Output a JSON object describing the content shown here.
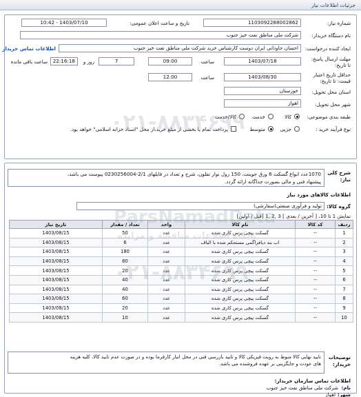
{
  "header": {
    "title": "جزئیات اطلاعات نیاز"
  },
  "form": {
    "need_number_label": "شماره نیاز:",
    "need_number": "1103092288002862",
    "announce_label": "تاریخ و ساعت اعلان عمومی:",
    "announce_value": "1403/07/10 - 10:42",
    "buyer_label": "نام دستگاه خریدار:",
    "buyer": "شرکت ملی مناطق نفت خیز جنوب",
    "creator_label": "ایجاد کننده درخواست:",
    "creator": "احسان جاودانی ایران دوست کارشناس خرید شرکت ملی مناطق نفت خیز جنوب",
    "contact_link": "اطلاعات تماس خریدار",
    "reply_deadline_label": "مهلت ارسال پاسخ:",
    "reply_until_label": "تا تاریخ:",
    "reply_date": "1403/07/18",
    "time_label": "ساعت",
    "reply_time": "09:00",
    "days_value": "7",
    "days_label": "روز و",
    "remaining_time": "22:16:18",
    "remaining_label": "ساعت باقی مانده",
    "price_validity_label": "حداقل تاریخ اعتبار",
    "price_validity_label2": "قیمت: تا تاریخ:",
    "validity_date": "1403/08/30",
    "validity_time": "12:00",
    "province_label": "استان محل تحویل:",
    "province": "خوزستان",
    "city_label": "شهر محل تحویل:",
    "city": "اهواز",
    "category_label": "طبقه بندی موضوعی:",
    "category_options": [
      "کالا",
      "خدمت",
      "کالا/خدمت"
    ],
    "purchase_label": "نوع فرآیند خرید :",
    "purchase_options": [
      "جزیی",
      "متوسط"
    ],
    "payment_text": "پرداخت تمام یا بخشی از مبلغ خرید،از محل \"اسناد خزانه اسلامی\" خواهد بود."
  },
  "description": {
    "label": "شرح کلی",
    "label2": "نیاز:",
    "text_line1": "1070عدد انواع گسکت 6 ورق جوینت، 150 رول نوار تفلون، شرح و تعداد در فایلهای 2/1-0230256004 پیوست می باشد،",
    "text_line2": "پیشنهاد فنی و مالی بصورت جداگانه ارائه گردد."
  },
  "goods": {
    "section_title": "اطلاعات کالاهای مورد نیاز",
    "group_label": "گروه کالا:",
    "group_value": "تولید و فرآوری صنعتی(سفارشی)",
    "pagination": "نمایش 1 تا 10، [ آخرین / بعدی ] 3 ,2 ,1 [قبل / اولین]",
    "columns": [
      "ردیف",
      "کد کالا",
      "نام کالا",
      "واحد",
      "تعداد / مقدار",
      "تاریخ نیاز"
    ],
    "rows": [
      [
        "1",
        "--",
        "گسکت پیچی پرس کاری شده",
        "عدد",
        "50",
        "1403/08/15"
      ],
      [
        "2",
        "--",
        "اب بند دیافراگمی مستحکم شده با الیاف",
        "عدد",
        "6",
        "1403/08/15"
      ],
      [
        "3",
        "--",
        "گسکت پیچی پرس کاری شده",
        "عدد",
        "180",
        "1403/08/15"
      ],
      [
        "4",
        "--",
        "گسکت پیچی پرس کاری شده",
        "عدد",
        "80",
        "1403/08/15"
      ],
      [
        "5",
        "--",
        "گسکت پیچی پرس کاری شده",
        "عدد",
        "20",
        "1403/08/15"
      ],
      [
        "6",
        "--",
        "گسکت پیچی پرس کاری شده",
        "عدد",
        "40",
        "1403/08/15"
      ],
      [
        "7",
        "--",
        "گسکت پیچی پرس کاری شده",
        "عدد",
        "40",
        "1403/08/15"
      ],
      [
        "8",
        "--",
        "گسکت پیچی پرس کاری شده",
        "عدد",
        "60",
        "1403/08/15"
      ],
      [
        "9",
        "--",
        "گسکت پیچی پرس کاری شده",
        "عدد",
        "20",
        "1403/08/15"
      ],
      [
        "10",
        "--",
        "گسکت پیچی پرس کاری شده",
        "عدد",
        "10",
        "1403/08/15"
      ]
    ]
  },
  "buyer_notes": {
    "label": "توضیحات",
    "label2": "خریدار:",
    "text_line1": "تایید نهایی کالا منوط به رویت فیزیکی کالا و تایید بازرسی فنی در محل انبار کارفرما بوده و در صورت عدم تایید کالا، کلیه هزینه",
    "text_line2": "های عودت و جایگزینی بر عهده فروشنده می باشد."
  },
  "contact": {
    "section_title": "اطلاعات تماس سازمان خریدار:",
    "org_label": "نام:",
    "org": "شرکت ملی مناطق نفت خیز جنوب",
    "city_label": "شهر:",
    "city": "اهواز"
  },
  "watermarks": {
    "phone": "۰۲۱-۸۸۳۴۶۹۹",
    "brand": "ParsNamadData",
    "tagline": "پایگاه اطلاعات مناقصه و مزایده"
  }
}
